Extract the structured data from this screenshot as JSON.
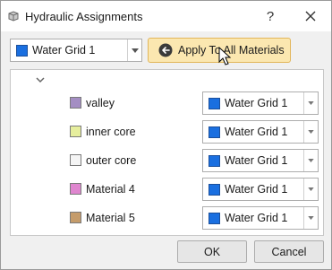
{
  "window": {
    "title": "Hydraulic Assignments",
    "help_label": "?"
  },
  "toolbar": {
    "selected_grid": "Water Grid 1",
    "selected_grid_color": "#1a6fe0",
    "apply_label": "Apply To All Materials"
  },
  "materials": [
    {
      "name": "valley",
      "color": "#a48ec3",
      "assignment": "Water Grid 1",
      "assignment_color": "#1a6fe0"
    },
    {
      "name": "inner core",
      "color": "#e6ee9d",
      "assignment": "Water Grid 1",
      "assignment_color": "#1a6fe0"
    },
    {
      "name": "outer core",
      "color": "#f5f5f5",
      "assignment": "Water Grid 1",
      "assignment_color": "#1a6fe0"
    },
    {
      "name": "Material 4",
      "color": "#df86cf",
      "assignment": "Water Grid 1",
      "assignment_color": "#1a6fe0"
    },
    {
      "name": "Material 5",
      "color": "#c59c6b",
      "assignment": "Water Grid 1",
      "assignment_color": "#1a6fe0"
    }
  ],
  "footer": {
    "ok_label": "OK",
    "cancel_label": "Cancel"
  },
  "icons": {
    "app": "hydraulic-app-icon",
    "close": "close-icon",
    "apply": "arrow-left-circle-icon",
    "dropdown": "chevron-down-icon",
    "collapse": "chevron-down-icon",
    "cursor": "mouse-pointer-icon"
  }
}
